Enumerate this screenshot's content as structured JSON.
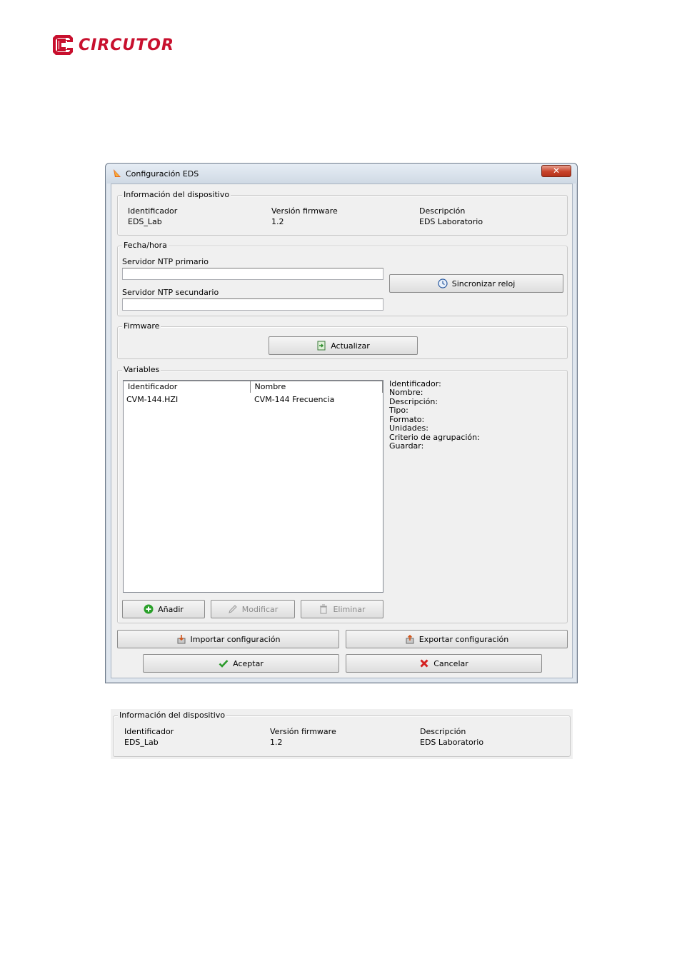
{
  "logo": {
    "text": "CIRCUTOR",
    "color": "#c8102e"
  },
  "window": {
    "title": "Configuración EDS",
    "close_label": "✕",
    "device_info": {
      "legend": "Información del dispositivo",
      "id_label": "Identificador",
      "id_value": "EDS_Lab",
      "fw_label": "Versión firmware",
      "fw_value": "1.2",
      "desc_label": "Descripción",
      "desc_value": "EDS Laboratorio"
    },
    "datetime": {
      "legend": "Fecha/hora",
      "ntp_primary_label": "Servidor NTP primario",
      "ntp_primary_value": "",
      "ntp_secondary_label": "Servidor NTP secundario",
      "ntp_secondary_value": "",
      "sync_label": "Sincronizar reloj"
    },
    "firmware": {
      "legend": "Firmware",
      "update_label": "Actualizar"
    },
    "variables": {
      "legend": "Variables",
      "columns": [
        "Identificador",
        "Nombre"
      ],
      "rows": [
        {
          "id": "CVM-144.HZI",
          "name": "CVM-144 Frecuencia"
        }
      ],
      "details": {
        "identificador": "Identificador:",
        "nombre": "Nombre:",
        "descripcion": "Descripción:",
        "tipo": "Tipo:",
        "formato": "Formato:",
        "unidades": "Unidades:",
        "criterio": "Criterio de agrupación:",
        "guardar": "Guardar:"
      },
      "add_label": "Añadir",
      "modify_label": "Modificar",
      "delete_label": "Eliminar"
    },
    "import_label": "Importar configuración",
    "export_label": "Exportar configuración",
    "accept_label": "Aceptar",
    "cancel_label": "Cancelar"
  },
  "panel2": {
    "legend": "Información del dispositivo",
    "id_label": "Identificador",
    "id_value": "EDS_Lab",
    "fw_label": "Versión firmware",
    "fw_value": "1.2",
    "desc_label": "Descripción",
    "desc_value": "EDS Laboratorio"
  }
}
